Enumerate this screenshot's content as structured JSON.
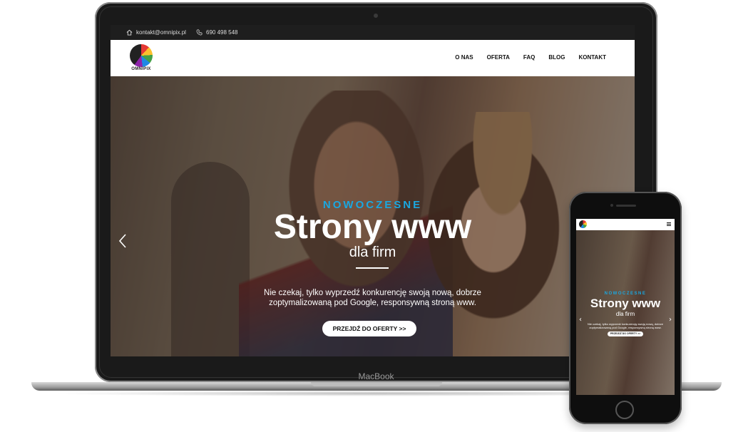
{
  "laptop": {
    "brand_label": "MacBook",
    "topbar": {
      "email": "kontakt@omnipix.pl",
      "phone": "690 498 548"
    },
    "logo_text": "OMNIPIX",
    "menu": [
      "O NAS",
      "OFERTA",
      "FAQ",
      "BLOG",
      "KONTAKT"
    ],
    "hero": {
      "subtitle": "NOWOCZESNE",
      "title": "Strony www",
      "title2": "dla firm",
      "description": "Nie czekaj, tylko wyprzedź konkurencję swoją nową, dobrze zoptymalizowaną pod Google, responsywną stroną www.",
      "button": "PRZEJDŹ DO OFERTY >>"
    }
  },
  "phone": {
    "hero": {
      "subtitle": "NOWOCZESNE",
      "title": "Strony www",
      "title2": "dla firm",
      "description": "Nie czekaj, tylko wyprzedź konkurencję swoją nową, dobrze zoptymalizowaną pod Google, responsywną stroną www.",
      "button": "PRZEJDŹ DO OFERTY >>"
    }
  },
  "colors": {
    "accent": "#1aa7e0",
    "topbar": "#1e1e1e",
    "device": "#1a1a1a"
  },
  "icons": [
    "home-icon",
    "phone-icon",
    "chevron-left-icon",
    "chevron-right-icon",
    "menu-icon"
  ]
}
